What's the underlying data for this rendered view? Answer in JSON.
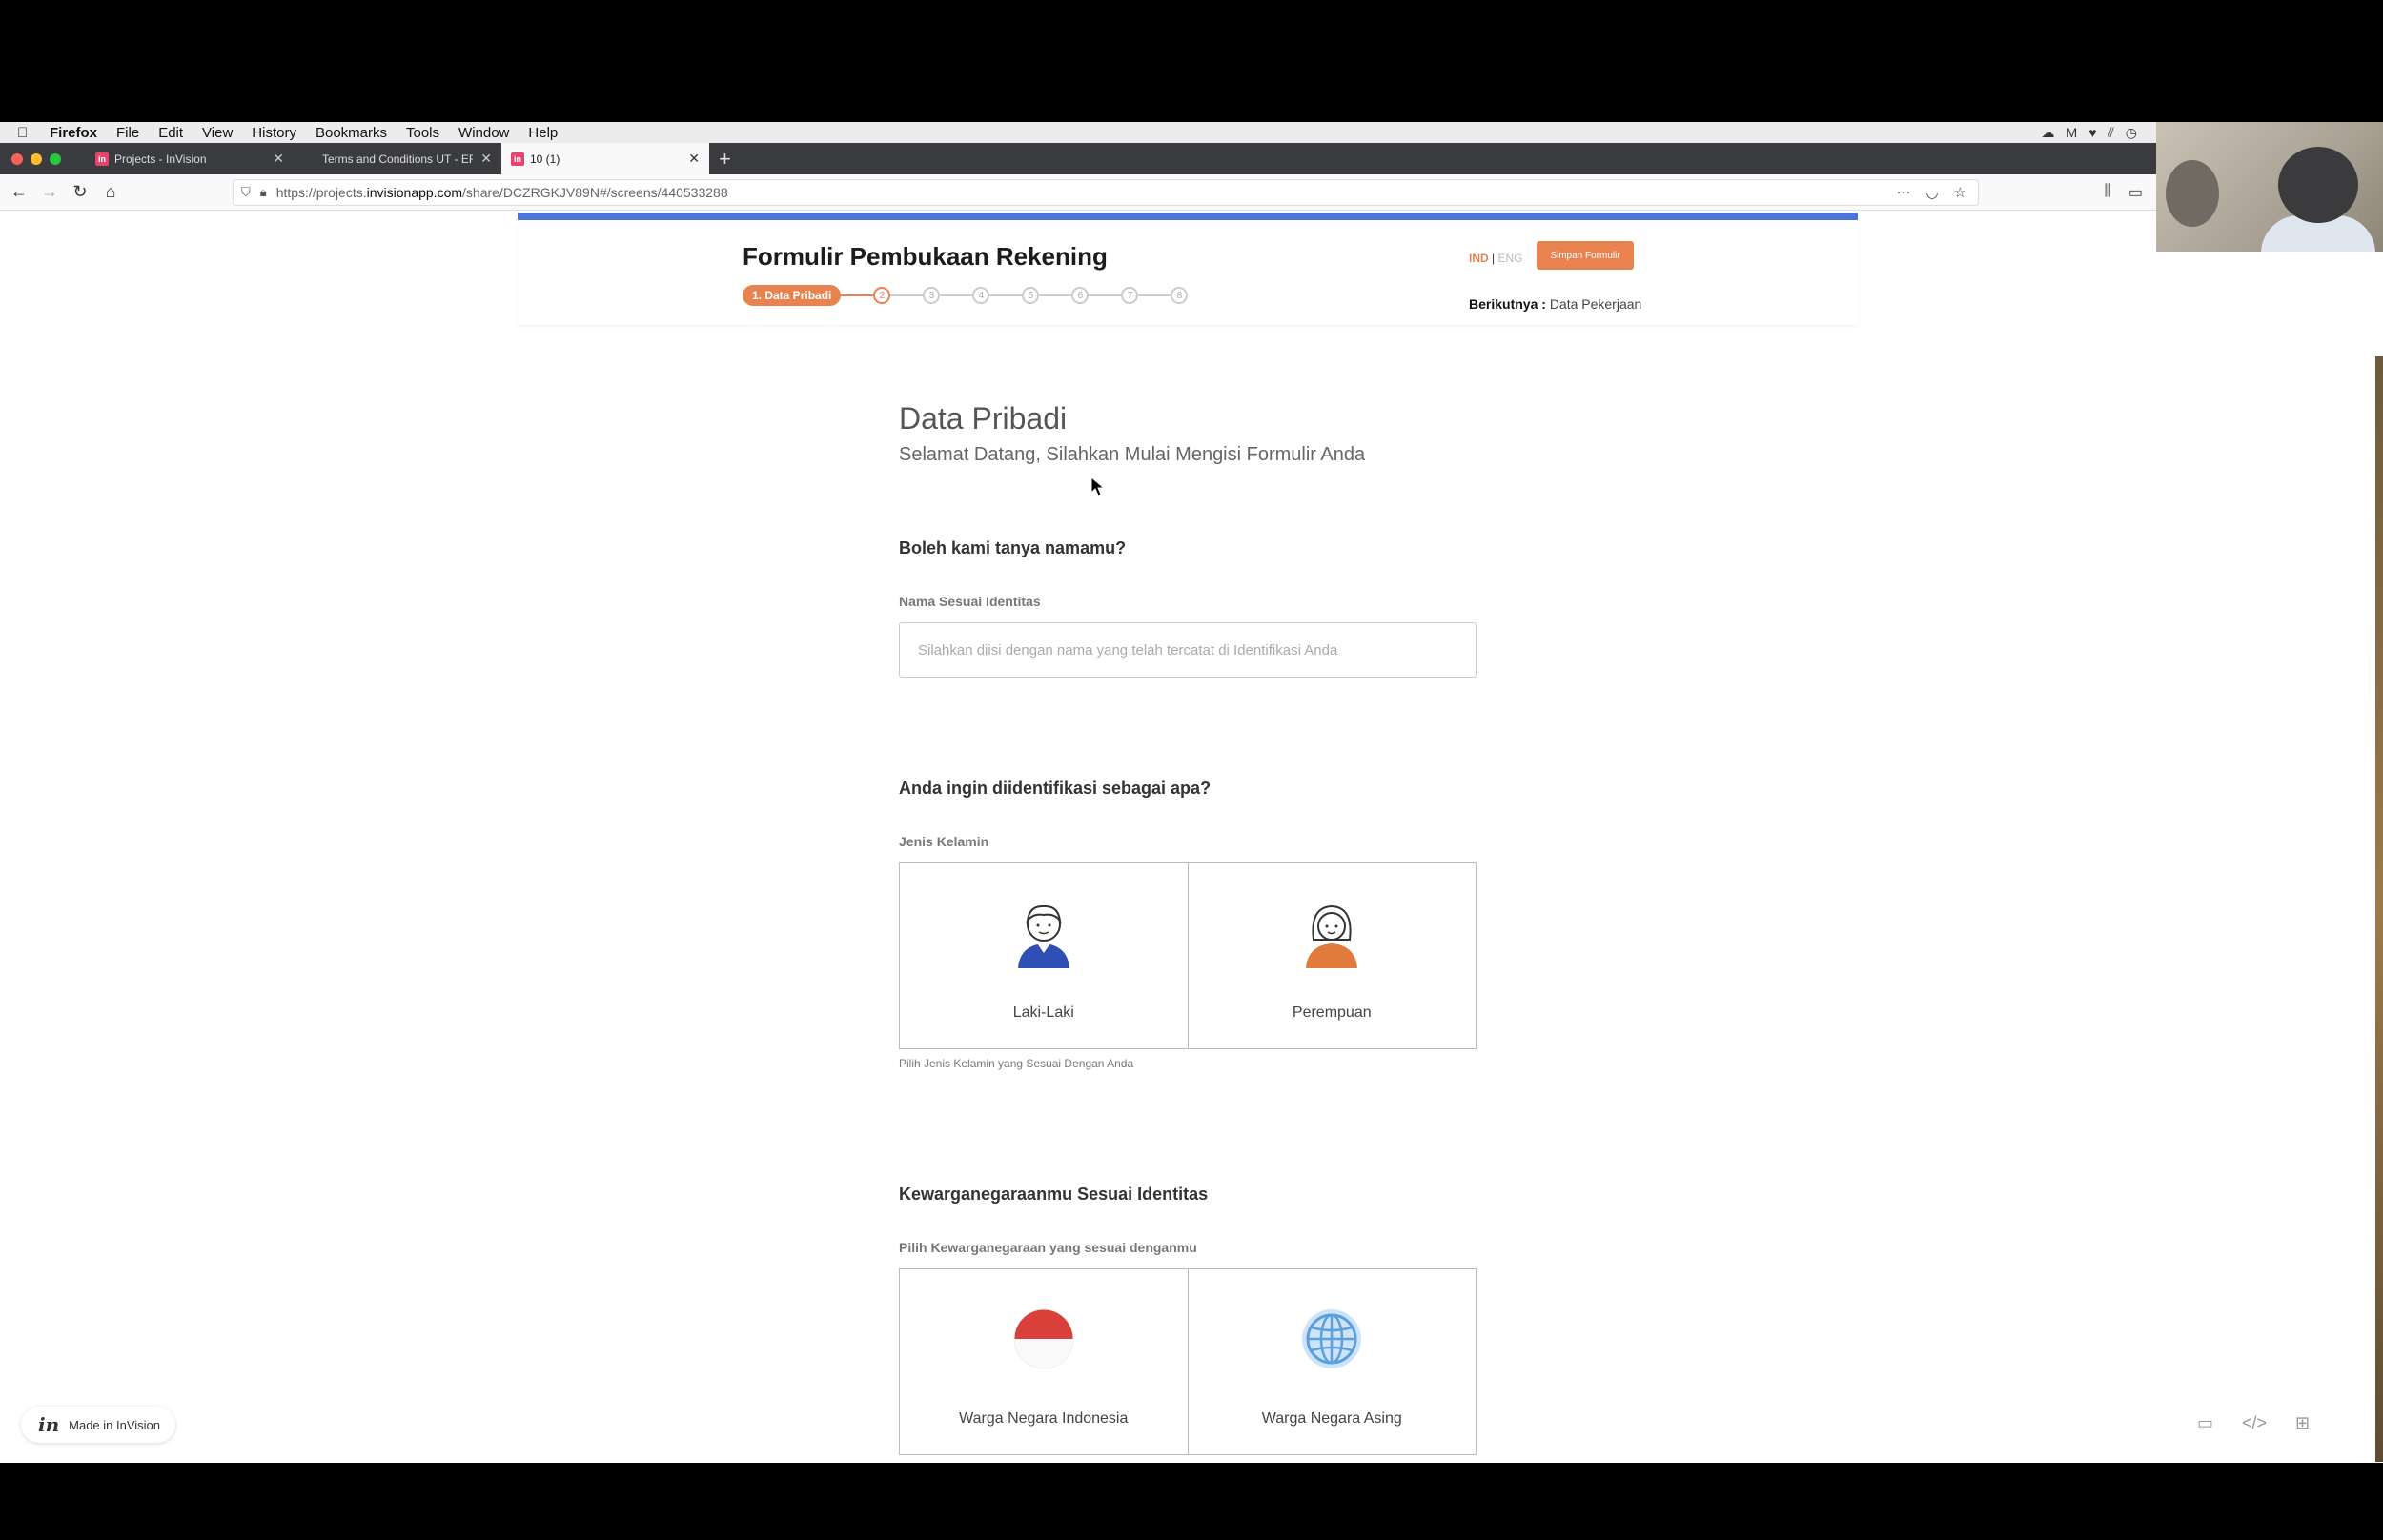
{
  "menubar": {
    "app": "Firefox",
    "items": [
      "File",
      "Edit",
      "View",
      "History",
      "Bookmarks",
      "Tools",
      "Window",
      "Help"
    ]
  },
  "tabs": [
    {
      "label": "Projects - InVision",
      "active": false
    },
    {
      "label": "Terms and Conditions UT - EFO",
      "active": false
    },
    {
      "label": "10 (1)",
      "active": true
    }
  ],
  "url": {
    "prefix": "https://projects.",
    "host": "invisionapp.com",
    "path": "/share/DCZRGKJV89N#/screens/440533288"
  },
  "header": {
    "title": "Formulir Pembukaan Rekening",
    "lang_ind": "IND",
    "lang_sep": "|",
    "lang_eng": "ENG",
    "save_label": "Simpan Formulir",
    "active_step": "1. Data Pribadi",
    "steps": [
      "2",
      "3",
      "4",
      "5",
      "6",
      "7",
      "8"
    ],
    "next_label": "Berikutnya :",
    "next_value": "Data Pekerjaan"
  },
  "content": {
    "title": "Data Pribadi",
    "subtitle": "Selamat Datang, Silahkan Mulai Mengisi Formulir Anda",
    "name_question": "Boleh kami tanya namamu?",
    "name_label": "Nama Sesuai Identitas",
    "name_placeholder": "Silahkan diisi dengan nama yang telah tercatat di Identifikasi Anda",
    "gender_question": "Anda ingin diidentifikasi sebagai apa?",
    "gender_label": "Jenis Kelamin",
    "gender_male": "Laki-Laki",
    "gender_female": "Perempuan",
    "gender_hint": "Pilih Jenis Kelamin yang Sesuai Dengan Anda",
    "citizen_question": "Kewarganegaraanmu Sesuai Identitas",
    "citizen_label": "Pilih Kewarganegaraan yang sesuai denganmu",
    "citizen_wni": "Warga Negara Indonesia",
    "citizen_wna": "Warga Negara Asing"
  },
  "footer": {
    "made_in": "Made in InVision"
  },
  "colors": {
    "accent": "#e8834f",
    "topline": "#4a74d9"
  }
}
